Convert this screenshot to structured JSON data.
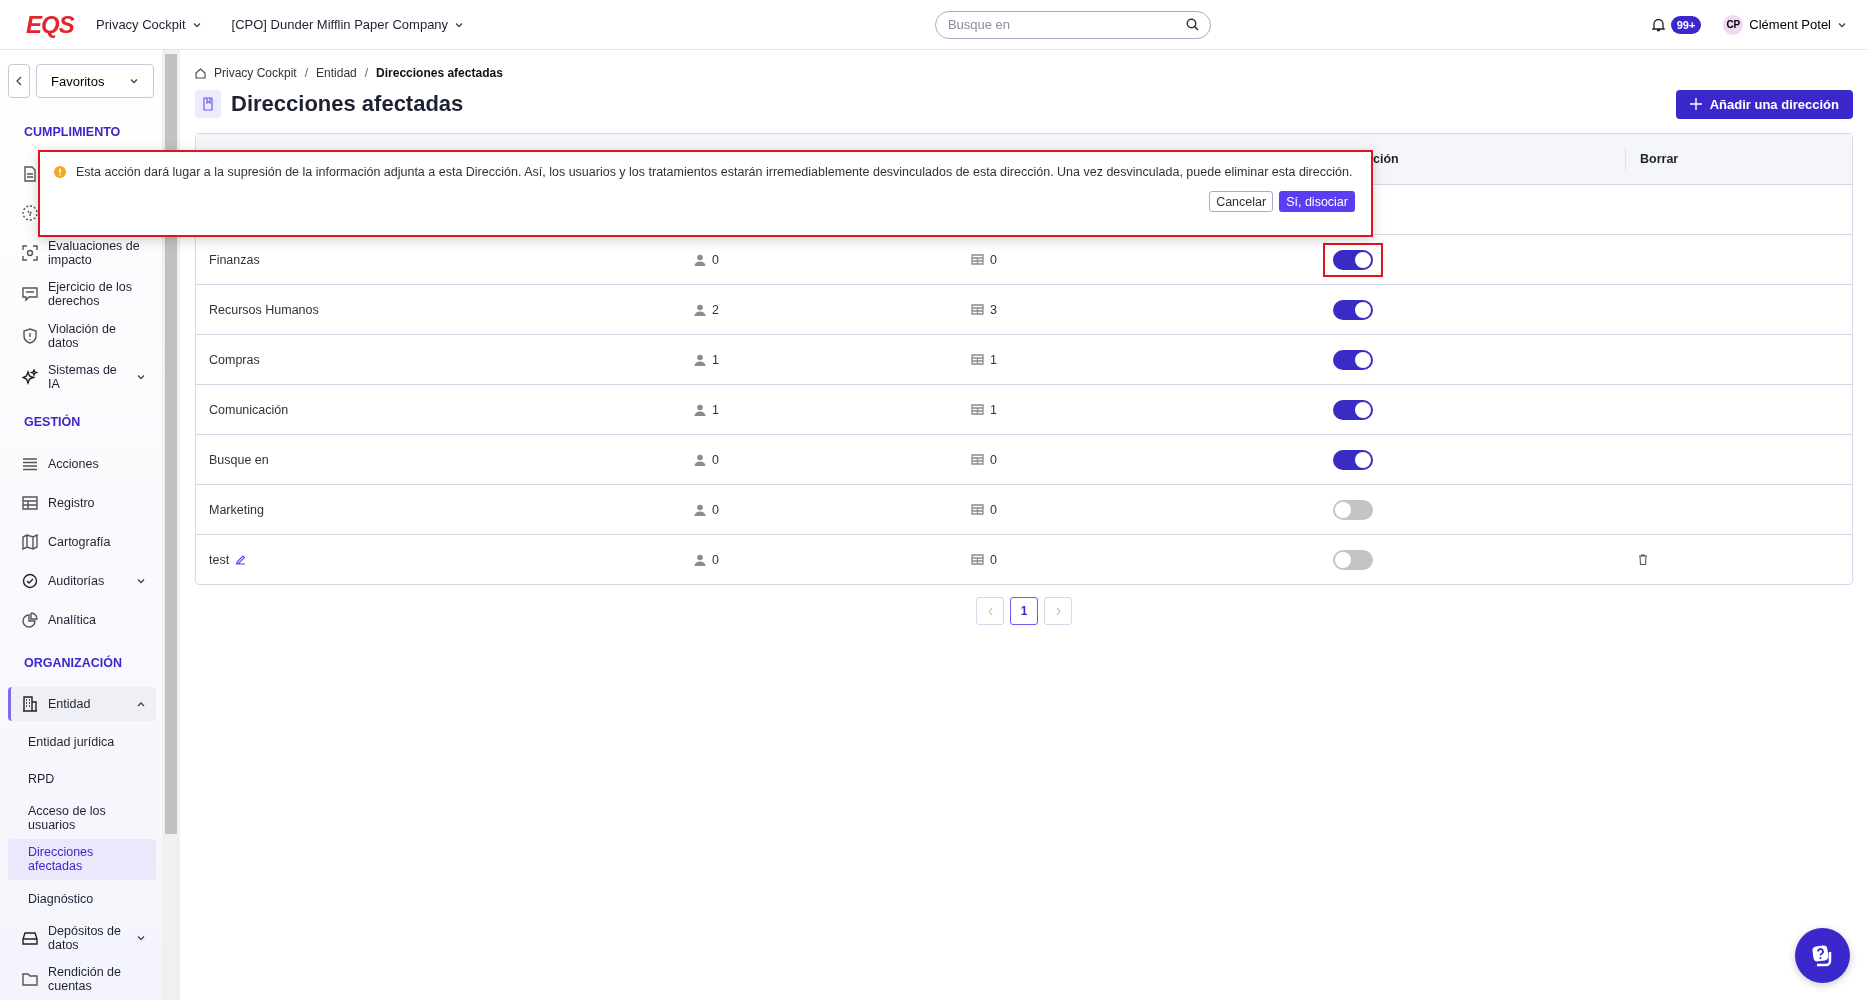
{
  "topbar": {
    "logo": "EQS",
    "app_menu": "Privacy Cockpit",
    "company_menu": "[CPO] Dunder Mifflin Paper Company",
    "search": {
      "placeholder": "Busque en"
    },
    "notifications": "99+",
    "user": {
      "initials": "CP",
      "name": "Clément Potel"
    }
  },
  "sidebar": {
    "favorites": "Favoritos",
    "sections": [
      {
        "title": "CUMPLIMIENTO",
        "items": [
          {
            "selected": false
          },
          {
            "selected": false
          },
          {
            "label": "Evaluaciones de impacto",
            "selected": false
          },
          {
            "label": "Ejercicio de los derechos",
            "selected": false
          },
          {
            "label": "Violación de datos",
            "selected": false
          },
          {
            "label": "Sistemas de IA",
            "expandable": true,
            "selected": false
          }
        ]
      },
      {
        "title": "GESTIÓN",
        "items": [
          {
            "label": "Acciones",
            "selected": false
          },
          {
            "label": "Registro",
            "selected": false
          },
          {
            "label": "Cartografía",
            "selected": false
          },
          {
            "label": "Auditorías",
            "expandable": true,
            "selected": false
          },
          {
            "label": "Analítica",
            "selected": false
          }
        ]
      },
      {
        "title": "ORGANIZACIÓN",
        "items": [
          {
            "label": "Entidad",
            "expandable": true,
            "expanded": true,
            "selected": false,
            "children": [
              {
                "label": "Entidad jurídica",
                "selected": false
              },
              {
                "label": "RPD",
                "selected": false
              },
              {
                "label": "Acceso de los usuarios",
                "selected": false
              },
              {
                "label": "Direcciones afectadas",
                "selected": true
              },
              {
                "label": "Diagnóstico",
                "selected": false
              }
            ]
          },
          {
            "label": "Depósitos de datos",
            "expandable": true,
            "selected": false
          },
          {
            "label": "Rendición de cuentas",
            "selected": false
          }
        ]
      }
    ]
  },
  "breadcrumb": {
    "separator": "/",
    "items": [
      "Privacy Cockpit",
      "Entidad",
      "Direcciones afectadas"
    ]
  },
  "title": "Direcciones afectadas",
  "add_button": "Añadir una dirección",
  "table": {
    "columns": [
      {
        "label": "ción"
      },
      {
        "label": "Borrar"
      }
    ],
    "rows": [
      {
        "hidden": true
      },
      {
        "name": "Finanzas",
        "users": "0",
        "treatments": "0",
        "on": true,
        "highlighted": true,
        "editable": false
      },
      {
        "name": "Recursos Humanos",
        "users": "2",
        "treatments": "3",
        "on": true,
        "highlighted": false,
        "editable": false
      },
      {
        "name": "Compras",
        "users": "1",
        "treatments": "1",
        "on": true,
        "highlighted": false,
        "editable": false
      },
      {
        "name": "Comunicación",
        "users": "1",
        "treatments": "1",
        "on": true,
        "highlighted": false,
        "editable": false
      },
      {
        "name": "Busque en",
        "users": "0",
        "treatments": "0",
        "on": true,
        "highlighted": false,
        "editable": false
      },
      {
        "name": "Marketing",
        "users": "0",
        "treatments": "0",
        "on": false,
        "highlighted": false,
        "editable": false
      },
      {
        "name": "test",
        "users": "0",
        "treatments": "0",
        "on": false,
        "highlighted": false,
        "editable": true
      }
    ]
  },
  "pagination": {
    "pages": [
      {
        "label": "1",
        "selected": true
      }
    ]
  },
  "confirm_popup": {
    "message": "Esta acción dará lugar a la supresión de la información adjunta a esta Dirección. Así, los usuarios y los tratamientos estarán irremediablemente desvinculados de esta dirección. Una vez desvinculada, puede eliminar esta dirección.",
    "cancel": "Cancelar",
    "confirm": "Sí, disociar",
    "highlighted": true
  }
}
